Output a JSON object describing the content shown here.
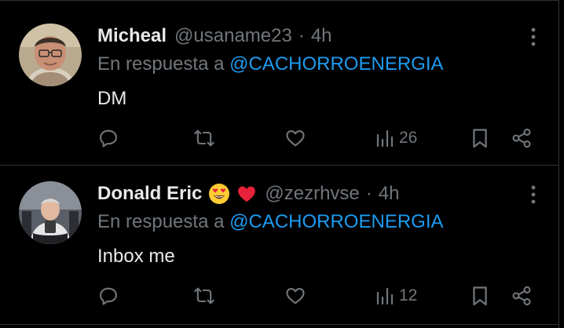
{
  "tweets": [
    {
      "name": "Micheal",
      "handle": "@usaname23",
      "separator": "·",
      "time": "4h",
      "reply_prefix": "En respuesta a",
      "reply_mention": "@CACHORROENERGIA",
      "text": "DM",
      "views": "26",
      "name_emojis": []
    },
    {
      "name": "Donald Eric",
      "handle": "@zezrhvse",
      "separator": "·",
      "time": "4h",
      "reply_prefix": "En respuesta a",
      "reply_mention": "@CACHORROENERGIA",
      "text": "Inbox me",
      "views": "12",
      "name_emojis": [
        "heart-eyes-emoji",
        "red-heart-emoji"
      ]
    }
  ],
  "colors": {
    "background": "#000000",
    "text_primary": "#e7e9ea",
    "text_secondary": "#71767b",
    "mention": "#1d9bf0",
    "divider": "#2f3336"
  },
  "icons": [
    "reply-icon",
    "retweet-icon",
    "like-icon",
    "views-icon",
    "bookmark-icon",
    "share-icon",
    "more-options-icon"
  ]
}
